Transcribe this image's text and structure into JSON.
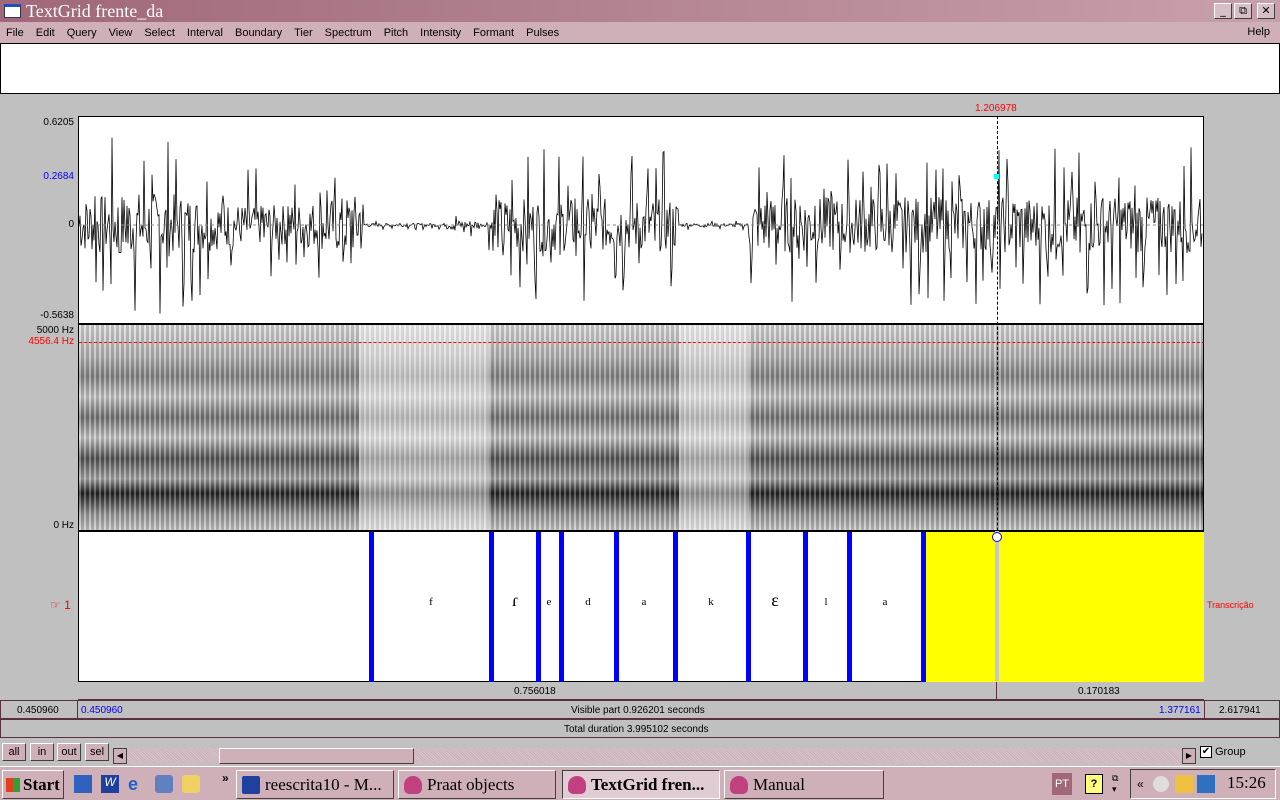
{
  "window": {
    "title": "TextGrid frente_da",
    "controls": [
      "_",
      "⧉",
      "✕"
    ]
  },
  "menu": [
    "File",
    "Edit",
    "Query",
    "View",
    "Select",
    "Interval",
    "Boundary",
    "Tier",
    "Spectrum",
    "Pitch",
    "Intensity",
    "Formant",
    "Pulses"
  ],
  "help": "Help",
  "cursor": {
    "time": "1.206978"
  },
  "waveform": {
    "max": "0.6205",
    "cursor_value": "0.2684",
    "zero": "0",
    "min": "-0.5638"
  },
  "spectrogram": {
    "top": "5000 Hz",
    "cursor_freq": "4556.4 Hz",
    "bottom": "0 Hz"
  },
  "tier": {
    "number": "☞ 1",
    "name": "Transcrição",
    "segments": [
      "f",
      "ɾ",
      "e",
      "d",
      "a",
      "k",
      "ɛ",
      "l",
      "a"
    ]
  },
  "durations": {
    "left": "0.756018",
    "right": "0.170183"
  },
  "timebar": {
    "window_start": "0.450960",
    "visible_start": "0.450960",
    "visible_part": "Visible part 0.926201 seconds",
    "visible_end": "1.377161",
    "window_end": "2.617941",
    "total": "Total duration 3.995102 seconds"
  },
  "buttons": {
    "all": "all",
    "in": "in",
    "out": "out",
    "sel": "sel",
    "group": "Group",
    "group_checked": true
  },
  "taskbar": {
    "start": "Start",
    "tasks": [
      "reescrita10 - M...",
      "Praat objects",
      "TextGrid fren...",
      "Manual"
    ],
    "lang": "PT",
    "clock": "15:26",
    "more": "»"
  }
}
